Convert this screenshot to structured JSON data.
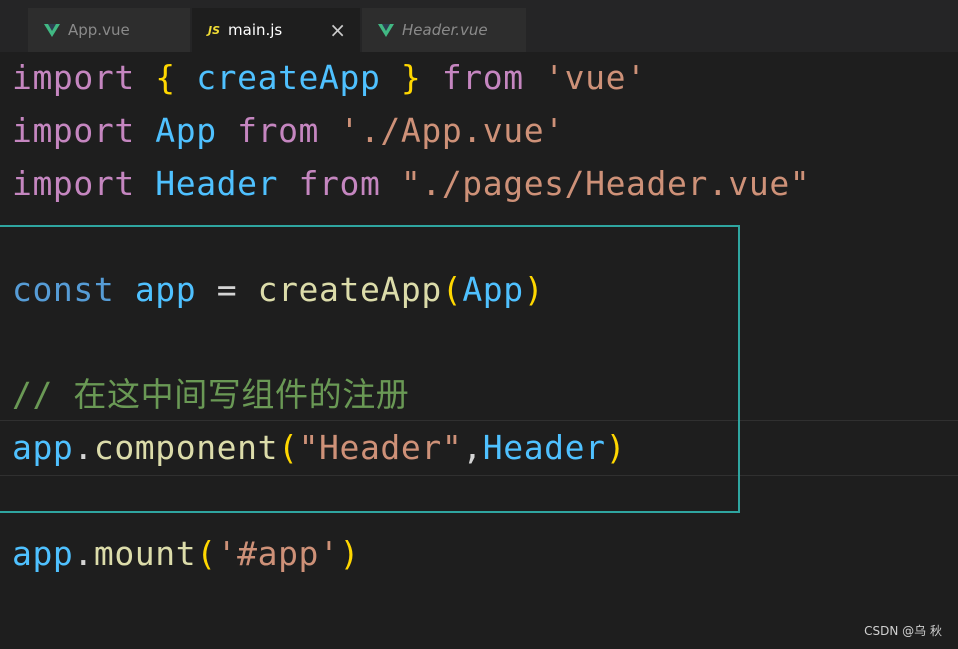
{
  "tabs": [
    {
      "label": "App.vue",
      "icon": "vue-icon"
    },
    {
      "label": "main.js",
      "icon": "js-icon",
      "active": true,
      "close": "×"
    },
    {
      "label": "Header.vue",
      "icon": "vue-icon"
    }
  ],
  "code": {
    "l1": {
      "kw": "import",
      "b1": "{",
      "id": "createApp",
      "b2": "}",
      "from": "from",
      "str": "'vue'"
    },
    "l2": {
      "kw": "import",
      "id": "App",
      "from": "from",
      "str": "'./App.vue'"
    },
    "l3": {
      "kw": "import",
      "id": "Header",
      "from": "from",
      "str": "\"./pages/Header.vue\""
    },
    "l4": {
      "const": "const",
      "var": "app",
      "eq": "=",
      "fn": "createApp",
      "p1": "(",
      "arg": "App",
      "p2": ")"
    },
    "l5": {
      "comment": "// 在这中间写组件的注册"
    },
    "l6": {
      "obj": "app",
      "dot": ".",
      "fn": "component",
      "p1": "(",
      "str": "\"Header\"",
      "comma": ",",
      "arg": "Header",
      "p2": ")"
    },
    "l7": {
      "obj": "app",
      "dot": ".",
      "fn": "mount",
      "p1": "(",
      "str": "'#app'",
      "p2": ")"
    }
  },
  "watermark": "CSDN @乌 秋",
  "colors": {
    "highlight_box": "#2fa5a0",
    "background": "#1e1e1e"
  }
}
